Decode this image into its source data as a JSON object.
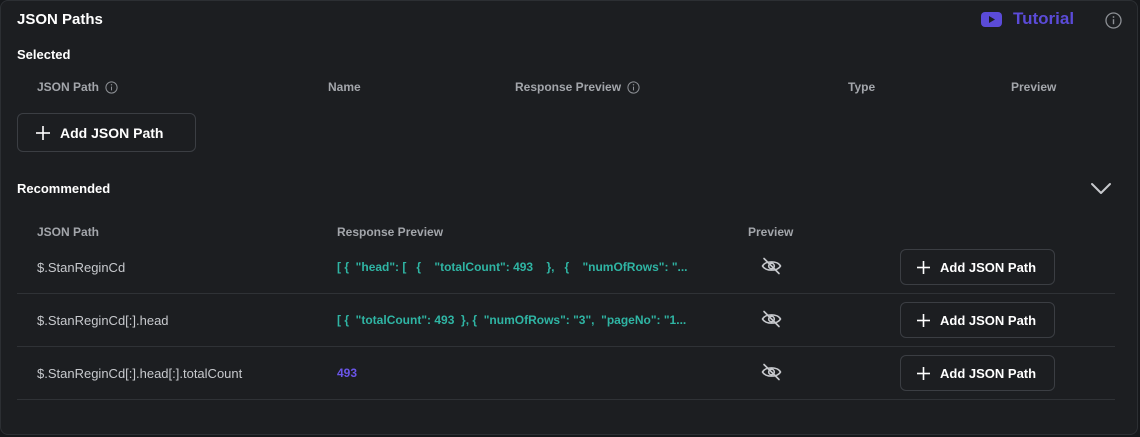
{
  "header": {
    "title": "JSON Paths",
    "tutorial_label": "Tutorial"
  },
  "selected": {
    "label": "Selected",
    "columns": {
      "json_path": "JSON Path",
      "name": "Name",
      "response_preview": "Response Preview",
      "type": "Type",
      "preview": "Preview"
    },
    "add_button_label": "Add JSON Path"
  },
  "recommended": {
    "label": "Recommended",
    "columns": {
      "json_path": "JSON Path",
      "response_preview": "Response Preview",
      "preview": "Preview"
    },
    "rows": [
      {
        "path": "$.StanReginCd",
        "preview": "[ {  \"head\": [   {    \"totalCount\": 493    },   {    \"numOfRows\": \"...",
        "add_label": "Add JSON Path"
      },
      {
        "path": "$.StanReginCd[:].head",
        "preview": "[ {  \"totalCount\": 493  }, {  \"numOfRows\": \"3\",  \"pageNo\": \"1...",
        "add_label": "Add JSON Path"
      },
      {
        "path": "$.StanReginCd[:].head[:].totalCount",
        "preview": "493",
        "add_label": "Add JSON Path"
      }
    ]
  },
  "colors": {
    "accent": "#5b4bd8",
    "preview_text": "#2fb5a4",
    "number_text": "#6a55e8"
  },
  "icons": [
    "youtube-icon",
    "info-icon",
    "plus-icon",
    "eye-off-icon",
    "chevron-down-icon"
  ]
}
